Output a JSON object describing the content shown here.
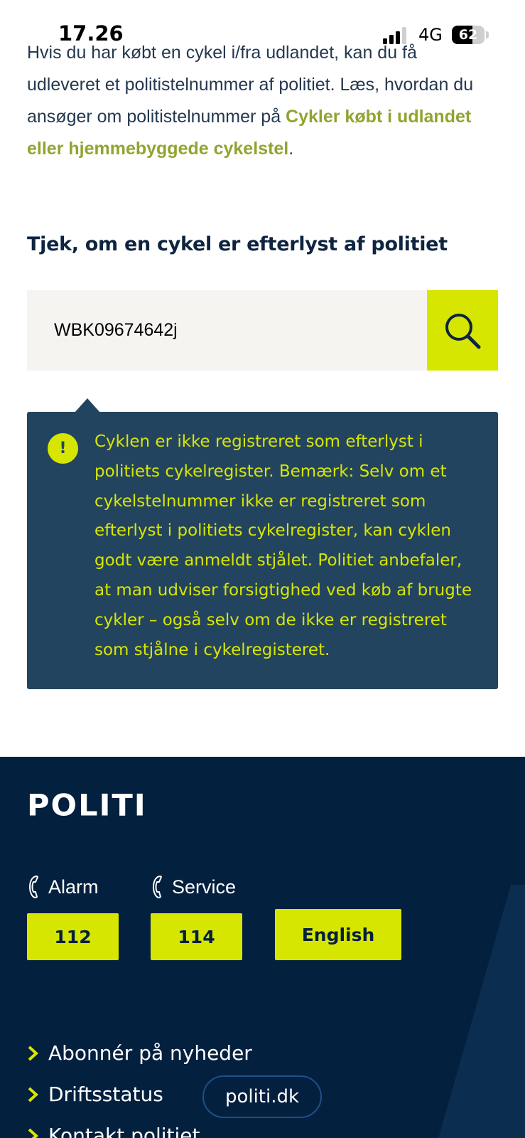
{
  "status_bar": {
    "time": "17.26",
    "network": "4G",
    "battery_percent": "62",
    "battery_level": 0.62
  },
  "intro": {
    "text_before": "Hvis du har købt en cykel i/fra udlandet, kan du få udleveret et politistelnummer af politiet. Læs, hvordan du ansøger om politistelnummer på ",
    "link_text": "Cykler købt i udlandet eller hjemmebyggede cykelstel",
    "text_after": "."
  },
  "search_section": {
    "heading": "Tjek, om en cykel er efterlyst af politiet",
    "input_value": "WBK09674642j",
    "button_icon": "search-icon"
  },
  "result": {
    "icon": "exclamation-icon",
    "text": "Cyklen er ikke registreret som efterlyst i politiets cykelregister. Bemærk: Selv om et cykelstelnummer ikke er registreret som efterlyst i politiets cykelregister, kan cyklen godt være anmeldt stjålet. Politiet anbefaler, at man udviser forsigtighed ved køb af brugte cykler – også selv om de ikke er registreret som stjålne i cykelregisteret."
  },
  "footer": {
    "logo": "POLITI",
    "alarm_label": "Alarm",
    "alarm_number": "112",
    "service_label": "Service",
    "service_number": "114",
    "english_label": "English",
    "links": [
      {
        "label": "Abonnér på nyheder"
      },
      {
        "label": "Driftsstatus"
      },
      {
        "label": "Kontakt politiet"
      }
    ],
    "site_pill": "politi.dk"
  },
  "colors": {
    "accent": "#d7e600",
    "navy": "#04203f",
    "notice_bg": "#23445f",
    "link": "#93a330"
  }
}
